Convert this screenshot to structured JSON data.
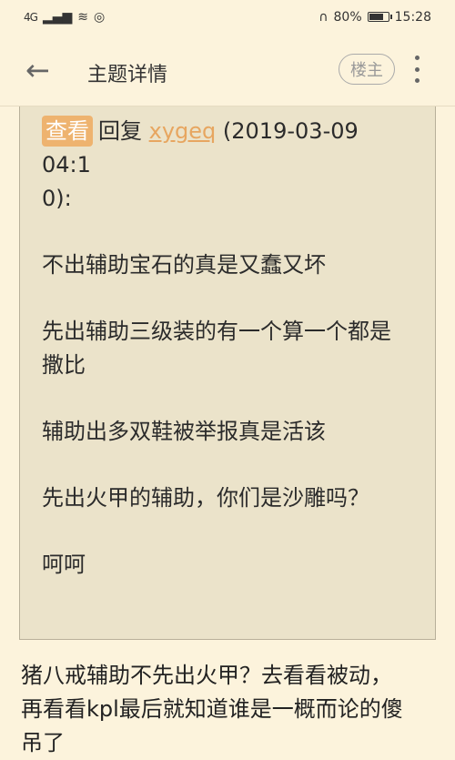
{
  "status_bar": {
    "network": "4G",
    "battery": "80%",
    "time": "15:28"
  },
  "header": {
    "title": "主题详情",
    "op_badge": "楼主"
  },
  "quote": {
    "view_label": "查看",
    "reply_prefix": "回复",
    "username": "xygeq",
    "timestamp_line1": "(2019-03-09 04:1",
    "timestamp_line2": "0):",
    "lines": [
      "不出辅助宝石的真是又蠢又坏",
      "先出辅助三级装的有一个算一个都是",
      "撒比",
      "辅助出多双鞋被举报真是活该",
      "先出火甲的辅助，你们是沙雕吗？",
      "呵呵"
    ]
  },
  "reply": {
    "line1": "猪八戒辅助不先出火甲？去看看被动，",
    "line2": "再看看kpl最后就知道谁是一概而论的傻",
    "line3": "吊了"
  }
}
